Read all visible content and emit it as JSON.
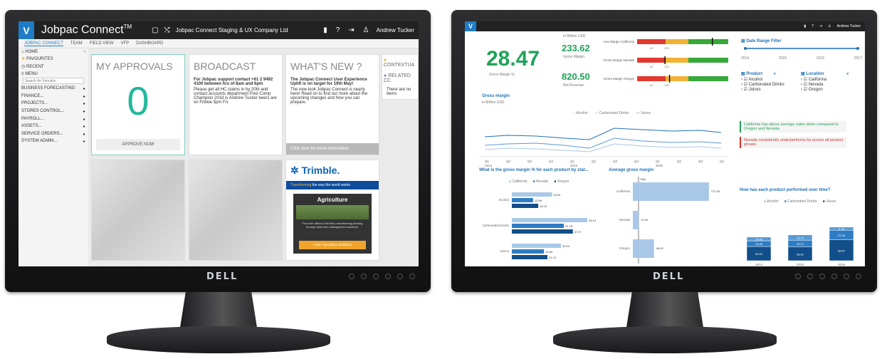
{
  "monitor_brand": "DELL",
  "left": {
    "app_title": "Jobpac Connect",
    "tm": "TM",
    "company": "Jobpac Connect Staging & UX Company Ltd",
    "user": "Andrew Tucker",
    "tabs": [
      "JOBPAC CONNECT",
      "TEAM",
      "FIELD VIEW",
      "VFP",
      "DASHBOARD"
    ],
    "sidebar": {
      "home": "HOME",
      "favourites": "FAVOURITES",
      "recent": "RECENT",
      "menu": "MENU",
      "search_placeholder": "Search for Function",
      "items": [
        "BUSINESS FORECASTING",
        "FINANCE...",
        "PROJECTS...",
        "STORES CONTROL...",
        "PAYROLL...",
        "ASSETS...",
        "SERVICE ORDERS...",
        "SYSTEM ADMIN..."
      ]
    },
    "approvals": {
      "title": "MY APPROVALS",
      "count": "0",
      "button": "APPROVE NOW"
    },
    "broadcast": {
      "title": "BROADCAST",
      "heading": "For Jobpac support contact +61 2 9492 4100 between hrs of 8am and 6pm",
      "body": "Please get all HC claims in by 20th and contact accounts department Pool Comp Champion 2018 is Andrew Tucker beers are on Frikkie 5pm Fri."
    },
    "whatsnew": {
      "title": "WHAT'S NEW ?",
      "heading": "The Jobpac Connect User Experience Uplift is on target for 19th May!",
      "body": "The new look Jobpac Connect is nearly here! Read on to find out more about the upcoming changes and how you can prepare.",
      "link": "Click here for more information"
    },
    "contextual": "CONTEXTUA",
    "related": "RELATED CC",
    "no_items": "There are no items",
    "trimble": {
      "logo": "Trimble.",
      "tagline_accent": "Transforming",
      "tagline": "the way the world works",
      "card_title": "Agriculture",
      "card_text": "From the office to the field, transforming farming through total farm management solutions.",
      "card_button": "Learn Agriculture Solutions"
    }
  },
  "right": {
    "user": "Andrew Tucker",
    "unit": "in Million USD",
    "kpi_main": {
      "value": "28.47",
      "label": "Gross Margin %"
    },
    "kpi_margin": {
      "value": "233.62",
      "label": "Gross Margin"
    },
    "kpi_revenue": {
      "value": "820.50",
      "label": "Net Revenue"
    },
    "bullets": [
      {
        "label": "Gross Margin California",
        "marker": 0.82
      },
      {
        "label": "Gross Margin Nevada",
        "marker": 0.3
      },
      {
        "label": "Gross Margin Oregon",
        "marker": 0.35
      }
    ],
    "bullet_ticks": [
      "40",
      "100"
    ],
    "date_filter": {
      "title": "Date Range Filter",
      "years": [
        "2014",
        "2015",
        "2016",
        "2017"
      ]
    },
    "product": {
      "title": "Product",
      "items": [
        "Alcohol",
        "Carbonated Drinks",
        "Juices"
      ]
    },
    "location": {
      "title": "Location",
      "items": [
        "California",
        "Nevada",
        "Oregon"
      ]
    },
    "note_good": "California has above average sales when compared to Oregon and Nevada.",
    "note_bad": "Nevada consistently underperforms for across all product groups.",
    "colors": {
      "accent": "#1f6fb5",
      "green": "#21a35a",
      "bad": "#d9302b"
    },
    "line_chart": {
      "title": "Gross margin",
      "unit": "in Million USD",
      "legend": [
        "Alcohol",
        "Carbonated Drinks",
        "Juices"
      ],
      "quarters": [
        "Q1",
        "Q2",
        "Q3",
        "Q4",
        "Q1",
        "Q2",
        "Q3",
        "Q4",
        "Q1",
        "Q2",
        "Q3",
        "Q4"
      ],
      "years": [
        "2014",
        "2015",
        "2016"
      ]
    },
    "hbar": {
      "title": "What is the gross margin % for each product by stat...",
      "legend": [
        "California",
        "Nevada",
        "Oregon"
      ],
      "products": [
        "Alcohol",
        "Carbonated Drinks",
        "Juices"
      ],
      "values": [
        [
          "24.52",
          "12.98",
          "16.13"
        ],
        [
          "46.14",
          "31.76",
          "37.27"
        ],
        [
          "30.00",
          "19.63",
          "21.74"
        ]
      ]
    },
    "avg": {
      "title": "Average gross margin",
      "marker": "Avg",
      "rows": [
        {
          "label": "California",
          "value": "172.43"
        },
        {
          "label": "Nevada",
          "value": "13.20"
        },
        {
          "label": "Oregon",
          "value": "48.00"
        }
      ]
    },
    "stack": {
      "title": "How has each product performed over time?",
      "legend": [
        "Alcohol",
        "Carbonated Drinks",
        "Juices"
      ],
      "years": [
        "2014",
        "2015",
        "2016"
      ],
      "labels": [
        [
          "40.02",
          "15.88",
          "10.48"
        ],
        [
          "38.61",
          "19.12",
          "14.74"
        ],
        [
          "58.57",
          "27.08",
          "8.78"
        ]
      ]
    }
  }
}
